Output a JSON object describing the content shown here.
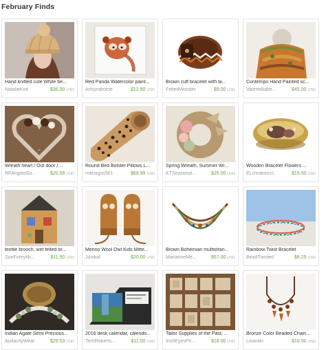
{
  "page": {
    "title": "February Finds"
  },
  "items": [
    {
      "name": "Hand knitted cute White be...",
      "shop": "NatalieKnit",
      "price": "$36.00",
      "currency": "USD",
      "image": "knit-hat-photo"
    },
    {
      "name": "Red Panda Watercolor paint...",
      "shop": "Artsyndrome",
      "price": "$12.90",
      "currency": "USD",
      "image": "red-panda-painting-photo"
    },
    {
      "name": "Brown cuff bracelet with la...",
      "shop": "FeltedWonder",
      "price": "$9.00",
      "currency": "USD",
      "image": "cuff-bracelet-photo"
    },
    {
      "name": "Contempo Hand Painted sc...",
      "shop": "ValerieBabe...",
      "price": "$45.00",
      "currency": "USD",
      "image": "painted-scarf-photo"
    },
    {
      "name": "Wreath heart / Out door / ...",
      "shop": "RFAngeloSo...",
      "price": "$20.59",
      "currency": "USD",
      "image": "heart-wreath-photo"
    },
    {
      "name": "Round Bed Bolster Pillows L...",
      "shop": "rrdesigns561",
      "price": "$69.99",
      "currency": "USD",
      "image": "leopard-pillow-photo"
    },
    {
      "name": "Spring Wreath, Summer Wr...",
      "shop": "KTSeasonal...",
      "price": "$25.00",
      "currency": "USD",
      "image": "burlap-wreath-photo"
    },
    {
      "name": "Wooden Bracelet Flowers ...",
      "shop": "ELcreations1",
      "price": "$15.00",
      "currency": "USD",
      "image": "wooden-bracelet-photo"
    },
    {
      "name": "textile brooch, wet felted br...",
      "shop": "SueForeyfib...",
      "price": "$11.90",
      "currency": "USD",
      "image": "house-brooch-photo"
    },
    {
      "name": "Merino Wool Owl Kids Mitte...",
      "shop": "Junikid",
      "price": "$20.00",
      "currency": "USD",
      "image": "owl-mittens-photo"
    },
    {
      "name": "Brown Bohemian multistran...",
      "shop": "MarianneMe...",
      "price": "$57.00",
      "currency": "USD",
      "image": "bohemian-necklace-photo"
    },
    {
      "name": "Rainbow Twist Bracelet",
      "shop": "BeadTwisted",
      "price": "$8.25",
      "currency": "USD",
      "image": "rainbow-bracelet-photo"
    },
    {
      "name": "Indian Agate Semi Precious...",
      "shop": "AudacityWear",
      "price": "$29.53",
      "currency": "USD",
      "image": "agate-necklace-photo"
    },
    {
      "name": "2016 desk calendar, calendo...",
      "shop": "TerriRoberts...",
      "price": "$11.00",
      "currency": "USD",
      "image": "desk-calendar-photo"
    },
    {
      "name": "Tailor Supplies of the Past, ...",
      "shop": "IrishEyesPh...",
      "price": "$18.00",
      "currency": "USD",
      "image": "tailor-supplies-photo"
    },
    {
      "name": "Bronze Color Beaded Chain...",
      "shop": "Linarain",
      "price": "$18.00",
      "currency": "USD",
      "image": "beaded-chain-photo"
    }
  ]
}
